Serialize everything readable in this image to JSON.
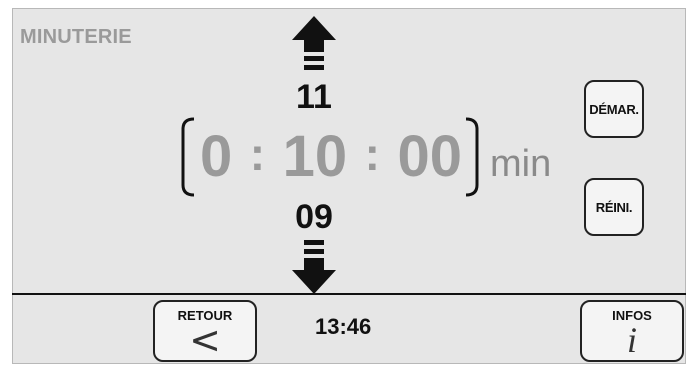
{
  "screen": {
    "title": "MINUTERIE",
    "colors": {
      "background": "#e6e6e6",
      "display_digits": "#9a9a9a",
      "text": "#111111"
    }
  },
  "timer": {
    "next_value": "11",
    "prev_value": "09",
    "hours": "0",
    "minutes": "10",
    "seconds": "00",
    "separator": ":",
    "unit": "min",
    "increase_icon": "arrow-up-icon",
    "decrease_icon": "arrow-down-icon"
  },
  "controls": {
    "start_label": "DÉMAR.",
    "reset_label": "RÉINI."
  },
  "footer": {
    "back_label": "RETOUR",
    "back_glyph": "<",
    "back_icon": "chevron-left-icon",
    "clock": "13:46",
    "info_label": "INFOS",
    "info_glyph": "i",
    "info_icon": "info-icon"
  }
}
